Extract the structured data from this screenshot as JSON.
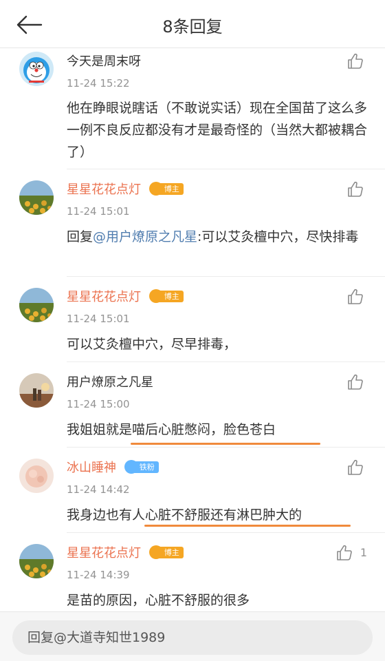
{
  "header": {
    "title": "8条回复",
    "back_icon": "back-arrow-icon"
  },
  "colors": {
    "accent": "#eb7350",
    "link": "#507daf",
    "underline": "#f08a3c",
    "badge_gold": "#f5a623",
    "badge_blue": "#62b6ff"
  },
  "comments": [
    {
      "name": "",
      "time": "11-24 15:22",
      "text": "他在睁眼说瞎话（不敢说实话）现在全国苗了这么多一例不良反应都没有才是最奇怪的（当然大都被耦合了）"
    },
    {
      "name": "星星花花点灯",
      "badge": "博主",
      "time": "11-24 15:01",
      "reply_prefix": "回复",
      "mention": "@用户燎原之凡星",
      "text": ":可以艾灸檀中穴，尽快排毒"
    },
    {
      "name": "星星花花点灯",
      "badge": "博主",
      "time": "11-24 15:01",
      "text": "可以艾灸檀中穴，尽早排毒，"
    },
    {
      "name": "用户燎原之凡星",
      "time": "11-24 15:00",
      "text": "我姐姐就是喵后心脏憋闷，脸色苍白"
    },
    {
      "name": "冰山睡神",
      "badge": "铁粉",
      "time": "11-24 14:42",
      "text": "我身边也有人心脏不舒服还有淋巴肿大的"
    },
    {
      "name": "星星花花点灯",
      "badge": "博主",
      "time": "11-24 14:39",
      "text": "是苗的原因，心脏不舒服的很多",
      "likes": "1"
    }
  ],
  "first_comment_text_top": "今天是周末呀",
  "reply_bar": {
    "placeholder": "回复@大道寺知世1989"
  }
}
